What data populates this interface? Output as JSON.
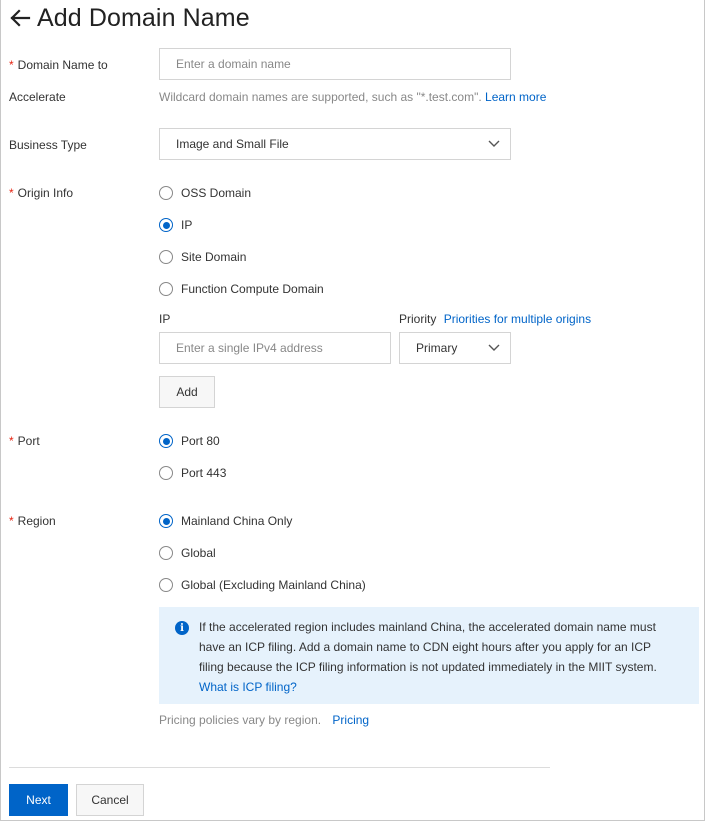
{
  "header": {
    "title": "Add Domain Name"
  },
  "domain": {
    "label_line1": "Domain Name to",
    "label_line2": "Accelerate",
    "placeholder": "Enter a domain name",
    "help": "Wildcard domain names are supported, such as \"*.test.com\".",
    "learn_more": "Learn more"
  },
  "business": {
    "label": "Business Type",
    "value": "Image and Small File"
  },
  "origin": {
    "label": "Origin Info",
    "options": [
      {
        "label": "OSS Domain",
        "selected": false
      },
      {
        "label": "IP",
        "selected": true
      },
      {
        "label": "Site Domain",
        "selected": false
      },
      {
        "label": "Function Compute Domain",
        "selected": false
      }
    ],
    "ip_label": "IP",
    "ip_placeholder": "Enter a single IPv4 address",
    "priority_label": "Priority",
    "priority_link": "Priorities for multiple origins",
    "priority_value": "Primary",
    "add_button": "Add"
  },
  "port": {
    "label": "Port",
    "options": [
      {
        "label": "Port 80",
        "selected": true
      },
      {
        "label": "Port 443",
        "selected": false
      }
    ]
  },
  "region": {
    "label": "Region",
    "options": [
      {
        "label": "Mainland China Only",
        "selected": true
      },
      {
        "label": "Global",
        "selected": false
      },
      {
        "label": "Global (Excluding Mainland China)",
        "selected": false
      }
    ],
    "notice_line1": "If the accelerated region includes mainland China, the accelerated domain name must",
    "notice_line2": "have an ICP filing. Add a domain name to CDN eight hours after you apply for an ICP",
    "notice_line3": "filing because the ICP filing information is not updated immediately in the MIIT system.",
    "notice_link": "What is ICP filing?",
    "pricing_text": "Pricing policies vary by region.",
    "pricing_link": "Pricing"
  },
  "footer": {
    "next": "Next",
    "cancel": "Cancel"
  },
  "colors": {
    "accent": "#0064c8",
    "required": "#e62412",
    "notice_bg": "#e6f2fc"
  }
}
